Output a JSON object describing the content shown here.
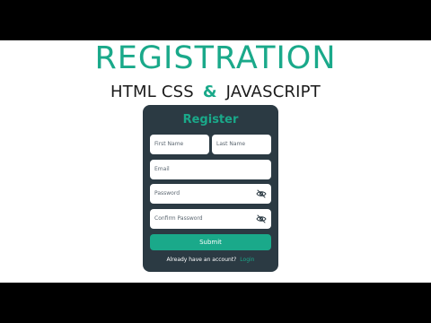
{
  "header": {
    "title": "REGISTRATION",
    "subtitle_left": "HTML CSS",
    "subtitle_amp": "&",
    "subtitle_right": "JAVASCRIPT"
  },
  "form": {
    "title": "Register",
    "fields": {
      "first_name": {
        "placeholder": "First Name"
      },
      "last_name": {
        "placeholder": "Last Name"
      },
      "email": {
        "placeholder": "Email"
      },
      "password": {
        "placeholder": "Password"
      },
      "confirm_password": {
        "placeholder": "Confirm Password"
      }
    },
    "submit_label": "Submit",
    "footer_text": "Already have an account?",
    "login_label": "Login"
  },
  "icons": {
    "eye_toggle": "eye-slash-icon"
  },
  "colors": {
    "accent": "#1aa98a",
    "card": "#2b3a43",
    "letterbox": "#000000",
    "background": "#ffffff"
  }
}
